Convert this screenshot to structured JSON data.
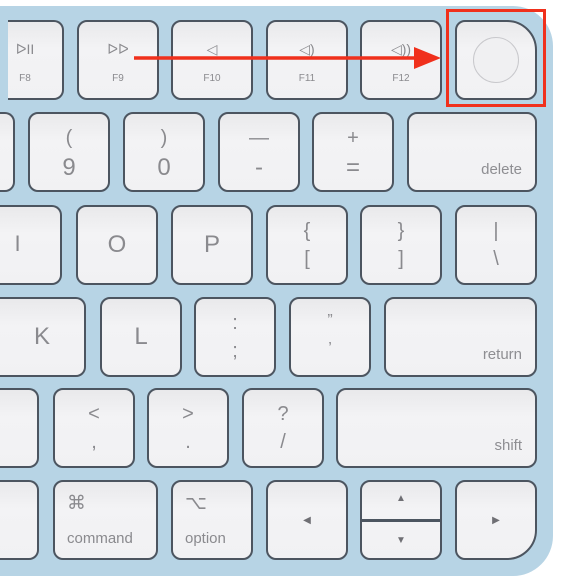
{
  "colors": {
    "keyboard_body": "#b7d4e5",
    "key_face": "#f1f1f3",
    "key_border": "#4c5560",
    "legend_text": "#8a8a8e",
    "highlight": "#f0301c"
  },
  "annotation": {
    "highlight_target": "touch-id-key",
    "arrow_direction": "right"
  },
  "function_row": [
    {
      "id": "f8",
      "icon": "play-pause-icon",
      "glyph": "ᐅII",
      "label": "F8"
    },
    {
      "id": "f9",
      "icon": "fast-forward-icon",
      "glyph": "ᐅᐅ",
      "label": "F9"
    },
    {
      "id": "f10",
      "icon": "mute-icon",
      "glyph": "◁",
      "label": "F10"
    },
    {
      "id": "f11",
      "icon": "volume-down-icon",
      "glyph": "◁)",
      "label": "F11"
    },
    {
      "id": "f12",
      "icon": "volume-up-icon",
      "glyph": "◁))",
      "label": "F12"
    }
  ],
  "touch_id": {
    "icon": "touch-id-icon"
  },
  "number_row": [
    {
      "top": "(",
      "bottom": "9"
    },
    {
      "top": ")",
      "bottom": "0"
    },
    {
      "top": "—",
      "bottom": "-"
    },
    {
      "top": "+",
      "bottom": "="
    }
  ],
  "delete_label": "delete",
  "top_letter_row": [
    {
      "letter": "I"
    },
    {
      "letter": "O"
    },
    {
      "letter": "P"
    },
    {
      "top": "{",
      "bottom": "["
    },
    {
      "top": "}",
      "bottom": "]"
    },
    {
      "top": "|",
      "bottom": "\\"
    }
  ],
  "home_row": [
    {
      "letter": "K"
    },
    {
      "letter": "L"
    },
    {
      "top": ":",
      "bottom": ";"
    },
    {
      "top": "”",
      "bottom": "’"
    }
  ],
  "return_label": "return",
  "bottom_letter_row": [
    {
      "top": "<",
      "bottom": ","
    },
    {
      "top": ">",
      "bottom": "."
    },
    {
      "top": "?",
      "bottom": "/"
    }
  ],
  "shift_label": "shift",
  "modifier_row": {
    "command": {
      "glyph": "⌘",
      "label": "command"
    },
    "option": {
      "glyph": "⌥",
      "label": "option"
    },
    "arrows": {
      "left": "◀",
      "up": "▲",
      "down": "▼",
      "right": "▶"
    }
  }
}
